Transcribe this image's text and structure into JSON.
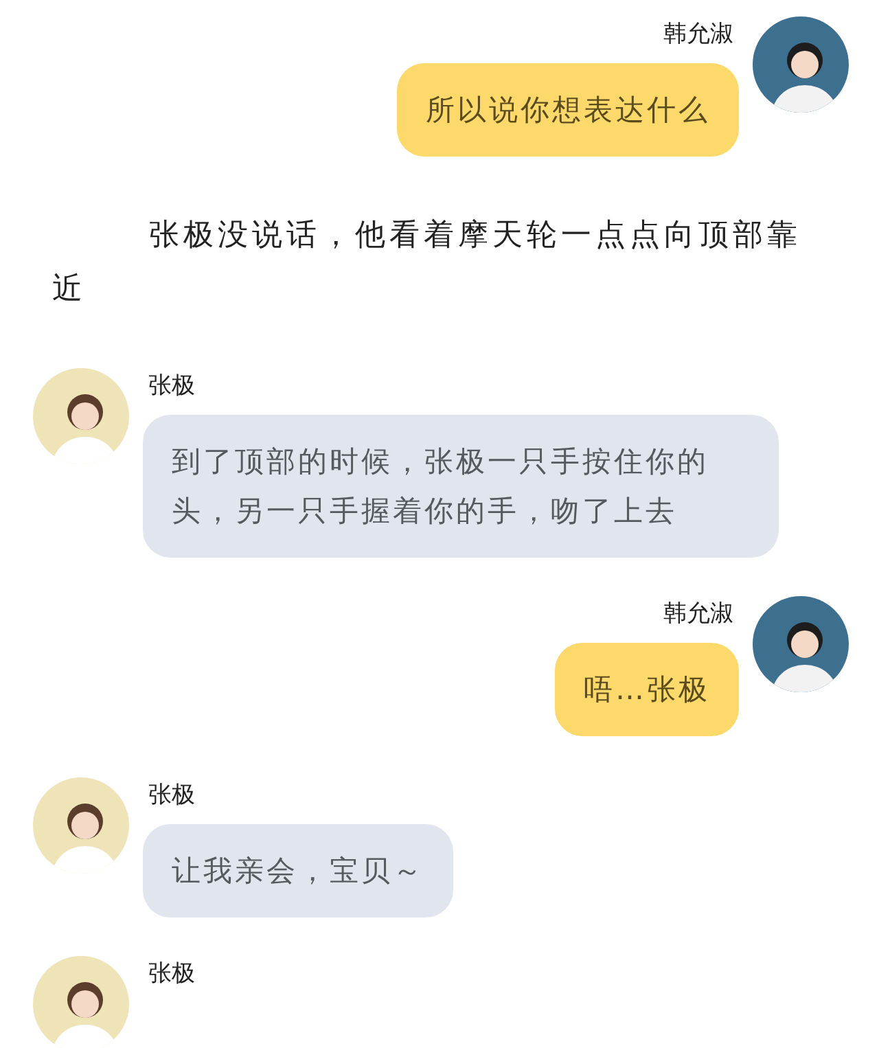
{
  "messages": [
    {
      "kind": "outgoing",
      "sender": "韩允淑",
      "text": "所以说你想表达什么"
    },
    {
      "kind": "narration",
      "text": "张极没说话，他看着摩天轮一点点向顶部靠近"
    },
    {
      "kind": "incoming",
      "sender": "张极",
      "text": "到了顶部的时候，张极一只手按住你的头，另一只手握着你的手，吻了上去"
    },
    {
      "kind": "outgoing",
      "sender": "韩允淑",
      "text": "唔…张极"
    },
    {
      "kind": "incoming",
      "sender": "张极",
      "text": "让我亲会，宝贝～"
    },
    {
      "kind": "incoming",
      "sender": "张极"
    }
  ]
}
